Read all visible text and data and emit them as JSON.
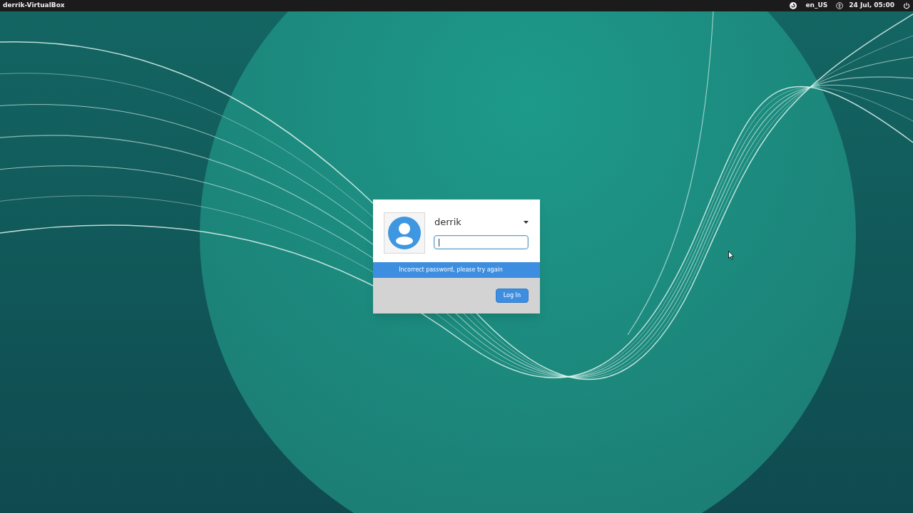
{
  "top_bar": {
    "hostname": "derrik-VirtualBox",
    "keyboard_layout": "en_US",
    "datetime": "24 Jul, 05:00"
  },
  "login": {
    "username": "derrik",
    "password_field": {
      "focused": true
    },
    "message": "Incorrect password, please try again",
    "button": "Log In"
  }
}
